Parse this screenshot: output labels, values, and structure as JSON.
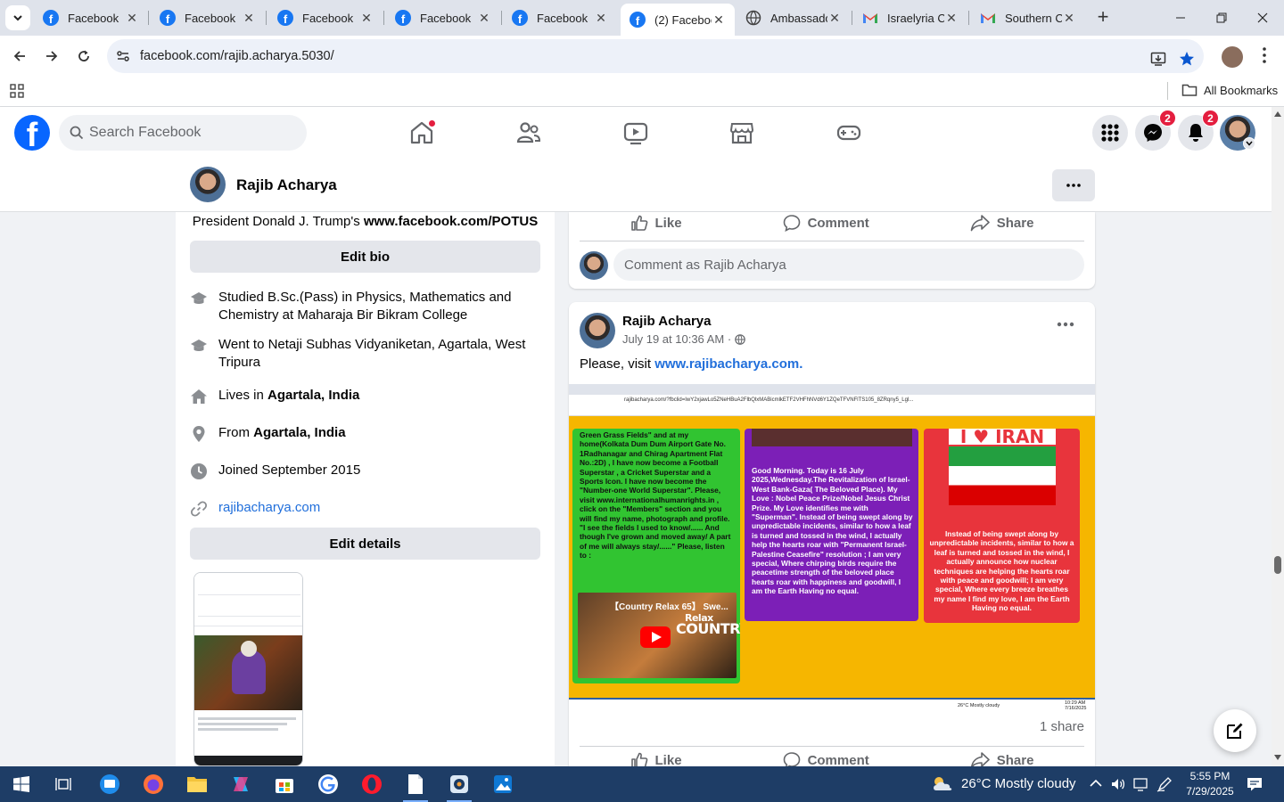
{
  "browser": {
    "tabs": [
      {
        "label": "Facebook",
        "icon": "facebook-icon"
      },
      {
        "label": "Facebook",
        "icon": "facebook-icon"
      },
      {
        "label": "Facebook",
        "icon": "facebook-icon"
      },
      {
        "label": "Facebook",
        "icon": "facebook-icon"
      },
      {
        "label": "Facebook",
        "icon": "facebook-icon"
      },
      {
        "label": "(2) Faceboo",
        "icon": "facebook-icon",
        "active": true
      },
      {
        "label": "Ambassado",
        "icon": "globe-icon"
      },
      {
        "label": "Israelyria C",
        "icon": "gmail-icon"
      },
      {
        "label": "Southern C",
        "icon": "gmail-icon"
      }
    ],
    "url": "facebook.com/rajib.acharya.5030/",
    "all_bookmarks": "All Bookmarks"
  },
  "fb_header": {
    "search_placeholder": "Search Facebook",
    "messenger_badge": "2",
    "notifications_badge": "2"
  },
  "profile": {
    "name": "Rajib Acharya"
  },
  "intro": {
    "bio_prefix": "President Donald J. Trump's ",
    "bio_link": "www.facebook.com/POTUS",
    "edit_bio": "Edit bio",
    "studied": "Studied B.Sc.(Pass) in Physics, Mathematics and Chemistry at Maharaja Bir Bikram College",
    "went_to": "Went to Netaji Subhas Vidyaniketan, Agartala, West Tripura",
    "lives_prefix": "Lives in ",
    "lives_place": "Agartala, India",
    "from_prefix": "From ",
    "from_place": "Agartala, India",
    "joined": "Joined September 2015",
    "website": "rajibacharya.com",
    "edit_details": "Edit details"
  },
  "post_actions": {
    "like": "Like",
    "comment": "Comment",
    "share": "Share"
  },
  "comment_placeholder": "Comment as Rajib Acharya",
  "post": {
    "author": "Rajib Acharya",
    "time": "July 19 at 10:36 AM",
    "separator": "·",
    "text_prefix": "Please, visit ",
    "text_link": "www.rajibacharya.com.",
    "image": {
      "inner_url": "rajibacharya.com/?fbclid=IwY2xjawLo5ZNeHBuA2FlbQlxMABicmlkETF2VHFhNVd6Y1ZQeTFVNFlTS105_8ZRqny5_Lgl...",
      "green_text": "Green Grass Fields\" and at my home(Kolkata Dum Dum Airport Gate No. 1Radhanagar and Chirag Apartment Flat No.:2D) , I have now become a Football Superstar , a Cricket Superstar and a Sports Icon. I have now become the \"Number-one World Superstar\". Please, visit www.internationalhumanrights.in , click on the \"Members\" section and you will find my name, photograph and profile. \"I see the fields I used to know/...... And though I've grown and moved away/ A part of me will always stay/......\" Please, listen to :",
      "video_title": "【Country Relax 65】 Swe...",
      "video_relax": "Relax",
      "video_country": "COUNTRY",
      "purple_text": "Good Morning. Today is 16 July 2025,Wednesday.The Revitalization of Israel-West Bank-Gaza( The Beloved Place). My Love : Nobel Peace Prize/Nobel Jesus Christ Prize. My Love identifies me with \"Superman\". Instead of being swept along by unpredictable incidents, similar to how a leaf is turned and tossed in the wind, I actually help the hearts roar with \"Permanent Israel-Palestine Ceasefire\" resolution ; I am very special, Where chirping birds require the peacetime strength of the beloved place hearts roar with happiness and goodwill, I am the Earth Having no equal.",
      "red_header": "I ♥ IRAN",
      "red_text": "Instead of being swept along by unpredictable incidents, similar to how a leaf is turned and tossed in the wind, I actually announce how nuclear techniques are helping the hearts roar with peace and goodwill; I am very special, Where every breeze breathes my name I find my love, I am the Earth Having no equal.",
      "inner_weather": "26°C  Mostly cloudy",
      "inner_time": "10:29 AM",
      "inner_date": "7/16/2025"
    },
    "shares": "1 share"
  },
  "taskbar": {
    "weather": "26°C  Mostly cloudy",
    "time": "5:55 PM",
    "date": "7/29/2025"
  },
  "colors": {
    "facebook_blue": "#0866ff",
    "link_blue": "#216fdb",
    "badge_red": "#e41e3f",
    "taskbar_bg": "#1e3d66"
  }
}
